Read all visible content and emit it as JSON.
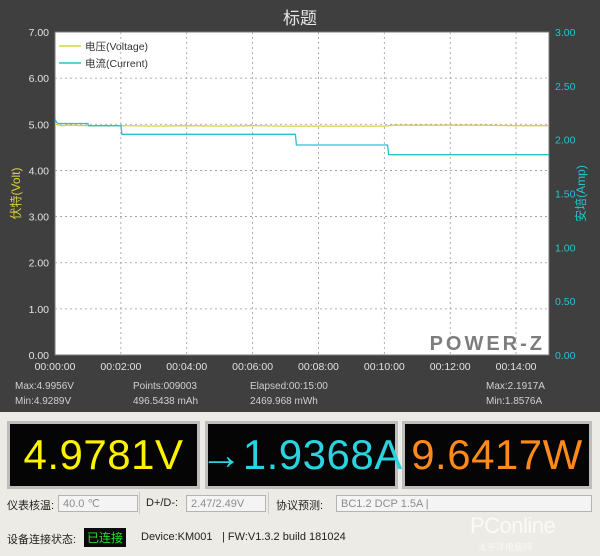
{
  "chart": {
    "title": "标题",
    "left_axis_label": "伏特(Volt)",
    "right_axis_label": "安培(Amp)",
    "legend": [
      {
        "label": "电压(Voltage)",
        "color": "#d8d23a"
      },
      {
        "label": "电流(Current)",
        "color": "#27c2cf"
      }
    ],
    "brand": "POWER-Z",
    "left_ticks": [
      "0.00",
      "1.00",
      "2.00",
      "3.00",
      "4.00",
      "5.00",
      "6.00",
      "7.00"
    ],
    "right_ticks": [
      "0.00",
      "0.50",
      "1.00",
      "1.50",
      "2.00",
      "2.50",
      "3.00"
    ],
    "x_ticks": [
      "00:00:00",
      "00:02:00",
      "00:04:00",
      "00:06:00",
      "00:08:00",
      "00:10:00",
      "00:12:00",
      "00:14:00"
    ]
  },
  "chart_data": {
    "type": "line",
    "title": "标题",
    "xlabel": "",
    "ylabel": "伏特(Volt)",
    "y2label": "安培(Amp)",
    "x_unit": "minutes",
    "xlim": [
      0,
      15
    ],
    "ylim": [
      0,
      7
    ],
    "y2lim": [
      0,
      3
    ],
    "grid": true,
    "legend_position": "top-left",
    "series": [
      {
        "name": "电压(Voltage)",
        "axis": "left",
        "color": "#d8d23a",
        "x": [
          0,
          0.2,
          0.4,
          1,
          2,
          3,
          4,
          5,
          6,
          7,
          8,
          9,
          10,
          10.3,
          11,
          12,
          13,
          14,
          15
        ],
        "y": [
          5.0,
          4.97,
          4.98,
          4.97,
          4.97,
          4.96,
          4.97,
          4.96,
          4.97,
          4.96,
          4.96,
          4.96,
          4.96,
          4.98,
          4.98,
          4.98,
          4.98,
          4.97,
          4.97
        ]
      },
      {
        "name": "电流(Current)",
        "axis": "right",
        "color": "#27c2cf",
        "x": [
          0,
          0.05,
          0.1,
          1.0,
          1.02,
          2.0,
          2.03,
          7.3,
          7.33,
          10.1,
          10.13,
          15
        ],
        "y": [
          2.19,
          2.16,
          2.15,
          2.15,
          2.13,
          2.13,
          2.05,
          2.05,
          1.95,
          1.95,
          1.86,
          1.86
        ]
      }
    ]
  },
  "stats": {
    "max_v": "Max:4.9956V",
    "min_v": "Min:4.9289V",
    "points": "Points:009003",
    "mah": "496.5438 mAh",
    "elapsed": "Elapsed:00:15:00",
    "mwh": "2469.968 mWh",
    "max_a": "Max:2.1917A",
    "min_a": "Min:1.8576A"
  },
  "readouts": {
    "voltage": "4.9781V",
    "current": "→1.9368A",
    "power": "9.6417W"
  },
  "fields": {
    "temp_label": "仪表核温:",
    "temp_value": "40.0 ℃",
    "dpdm_label": "D+/D-:",
    "dpdm_value": "2.47/2.49V",
    "protocol_label": "协议预测:",
    "protocol_value": "BC1.2 DCP 1.5A |"
  },
  "status": {
    "label": "设备连接状态:",
    "badge": "已连接",
    "device": "Device:KM001",
    "fw": "| FW:V1.3.2 build 181024"
  },
  "watermark": {
    "main": "PConline",
    "sub": "太平洋电脑网"
  }
}
